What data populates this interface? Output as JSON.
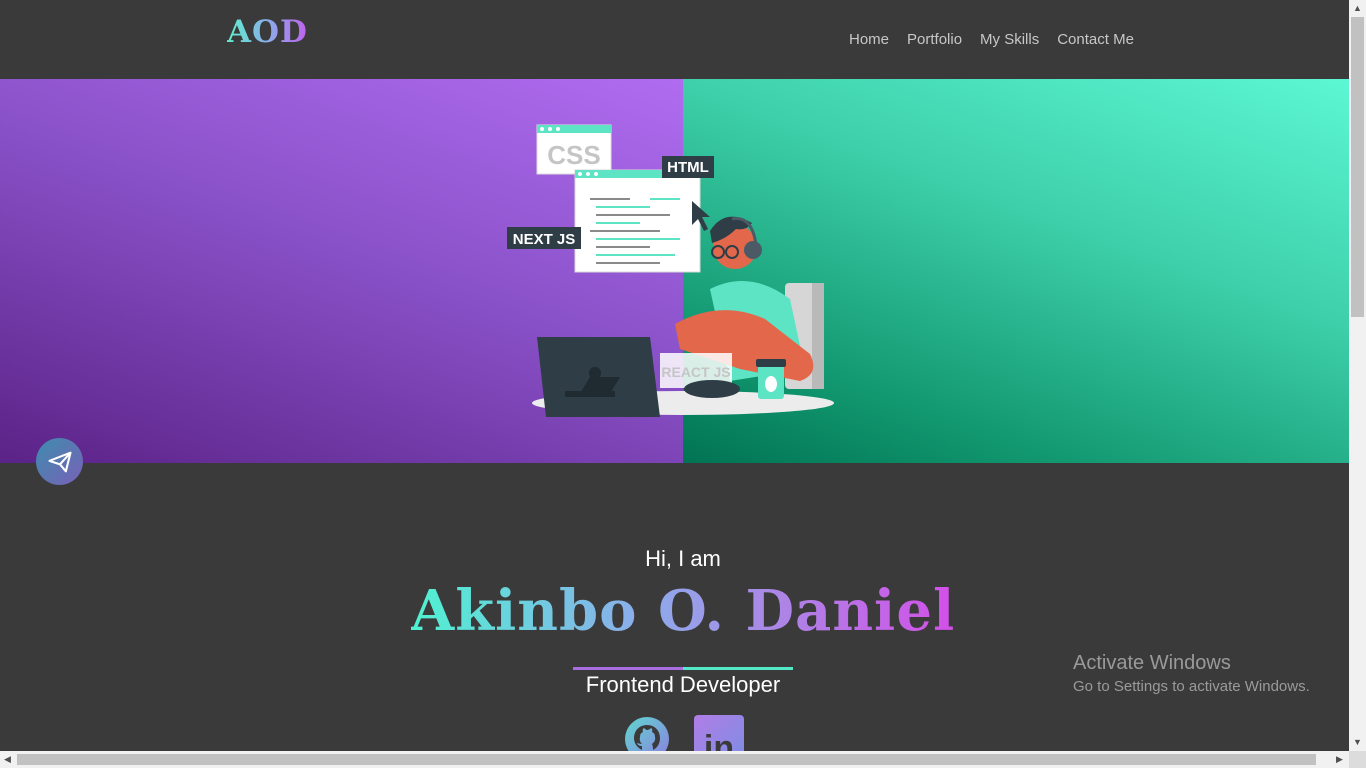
{
  "header": {
    "logo": "AOD",
    "nav": [
      {
        "label": "Home"
      },
      {
        "label": "Portfolio"
      },
      {
        "label": "My Skills"
      },
      {
        "label": "Contact Me"
      }
    ]
  },
  "hero": {
    "illustration": {
      "labels": [
        "CSS",
        "HTML",
        "NEXT JS",
        "REACT JS"
      ]
    }
  },
  "intro": {
    "greeting": "Hi, I am",
    "name": "Akinbo O. Daniel",
    "role": "Frontend Developer"
  },
  "social": {
    "linkedin_glyph": "in"
  },
  "overlay": {
    "activate_title": "Activate Windows",
    "activate_subtitle": "Go to Settings to activate Windows."
  },
  "icons": {
    "fab": "send-icon",
    "github": "github-icon",
    "linkedin": "linkedin-icon"
  },
  "colors": {
    "background": "#3a3a3a",
    "purple": "#8a52c9",
    "teal": "#3dcfa9",
    "accent_gradient_start": "#4ff2d1",
    "accent_gradient_end": "#d34fe8"
  }
}
